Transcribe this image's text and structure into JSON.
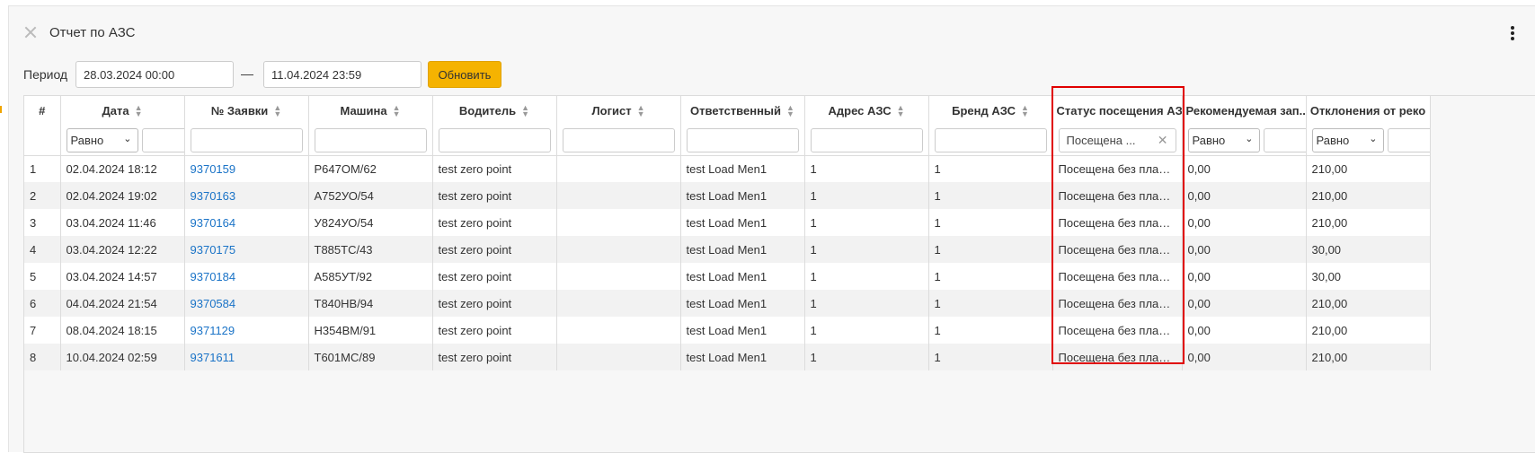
{
  "header": {
    "title": "Отчет по АЗС"
  },
  "period": {
    "label": "Период",
    "from": "28.03.2024 00:00",
    "separator": "—",
    "to": "11.04.2024 23:59",
    "refresh_label": "Обновить"
  },
  "colors": {
    "accent": "#f5b301",
    "link": "#1a73c7",
    "highlight": "#e00000"
  },
  "columns": [
    {
      "key": "num",
      "label": "#",
      "sortable": false,
      "filter": "none"
    },
    {
      "key": "date",
      "label": "Дата",
      "sortable": true,
      "filter": "select",
      "filter_value": "Равно"
    },
    {
      "key": "order",
      "label": "№ Заявки",
      "sortable": true,
      "filter": "text"
    },
    {
      "key": "car",
      "label": "Машина",
      "sortable": true,
      "filter": "text"
    },
    {
      "key": "driver",
      "label": "Водитель",
      "sortable": true,
      "filter": "text"
    },
    {
      "key": "logist",
      "label": "Логист",
      "sortable": true,
      "filter": "text"
    },
    {
      "key": "responsible",
      "label": "Ответственный",
      "sortable": true,
      "filter": "text"
    },
    {
      "key": "address",
      "label": "Адрес АЗС",
      "sortable": true,
      "filter": "text"
    },
    {
      "key": "brand",
      "label": "Бренд АЗС",
      "sortable": true,
      "filter": "text"
    },
    {
      "key": "status",
      "label": "Статус посещения АЗС",
      "sortable": false,
      "filter": "status",
      "filter_value": "Посещена ..."
    },
    {
      "key": "recommended",
      "label": "Рекомендуемая зап...",
      "sortable": false,
      "filter": "select",
      "filter_value": "Равно"
    },
    {
      "key": "deviation",
      "label": "Отклонения от реко",
      "sortable": false,
      "filter": "select",
      "filter_value": "Равно"
    }
  ],
  "rows": [
    {
      "num": "1",
      "date": "02.04.2024 18:12",
      "order": "9370159",
      "car": "Р647ОМ/62",
      "driver": "test zero point",
      "logist": "",
      "responsible": "test Load Men1",
      "address": "1",
      "brand": "1",
      "status": "Посещена без плани...",
      "recommended": "0,00",
      "deviation": "210,00"
    },
    {
      "num": "2",
      "date": "02.04.2024 19:02",
      "order": "9370163",
      "car": "А752УО/54",
      "driver": "test zero point",
      "logist": "",
      "responsible": "test Load Men1",
      "address": "1",
      "brand": "1",
      "status": "Посещена без плани...",
      "recommended": "0,00",
      "deviation": "210,00"
    },
    {
      "num": "3",
      "date": "03.04.2024 11:46",
      "order": "9370164",
      "car": "У824УО/54",
      "driver": "test zero point",
      "logist": "",
      "responsible": "test Load Men1",
      "address": "1",
      "brand": "1",
      "status": "Посещена без плани...",
      "recommended": "0,00",
      "deviation": "210,00"
    },
    {
      "num": "4",
      "date": "03.04.2024 12:22",
      "order": "9370175",
      "car": "Т885ТС/43",
      "driver": "test zero point",
      "logist": "",
      "responsible": "test Load Men1",
      "address": "1",
      "brand": "1",
      "status": "Посещена без плани...",
      "recommended": "0,00",
      "deviation": "30,00"
    },
    {
      "num": "5",
      "date": "03.04.2024 14:57",
      "order": "9370184",
      "car": "А585УТ/92",
      "driver": "test zero point",
      "logist": "",
      "responsible": "test Load Men1",
      "address": "1",
      "brand": "1",
      "status": "Посещена без плани...",
      "recommended": "0,00",
      "deviation": "30,00"
    },
    {
      "num": "6",
      "date": "04.04.2024 21:54",
      "order": "9370584",
      "car": "Т840НВ/94",
      "driver": "test zero point",
      "logist": "",
      "responsible": "test Load Men1",
      "address": "1",
      "brand": "1",
      "status": "Посещена без плани...",
      "recommended": "0,00",
      "deviation": "210,00"
    },
    {
      "num": "7",
      "date": "08.04.2024 18:15",
      "order": "9371129",
      "car": "Н354ВМ/91",
      "driver": "test zero point",
      "logist": "",
      "responsible": "test Load Men1",
      "address": "1",
      "brand": "1",
      "status": "Посещена без плани...",
      "recommended": "0,00",
      "deviation": "210,00"
    },
    {
      "num": "8",
      "date": "10.04.2024 02:59",
      "order": "9371611",
      "car": "Т601МС/89",
      "driver": "test zero point",
      "logist": "",
      "responsible": "test Load Men1",
      "address": "1",
      "brand": "1",
      "status": "Посещена без плани...",
      "recommended": "0,00",
      "deviation": "210,00"
    }
  ]
}
